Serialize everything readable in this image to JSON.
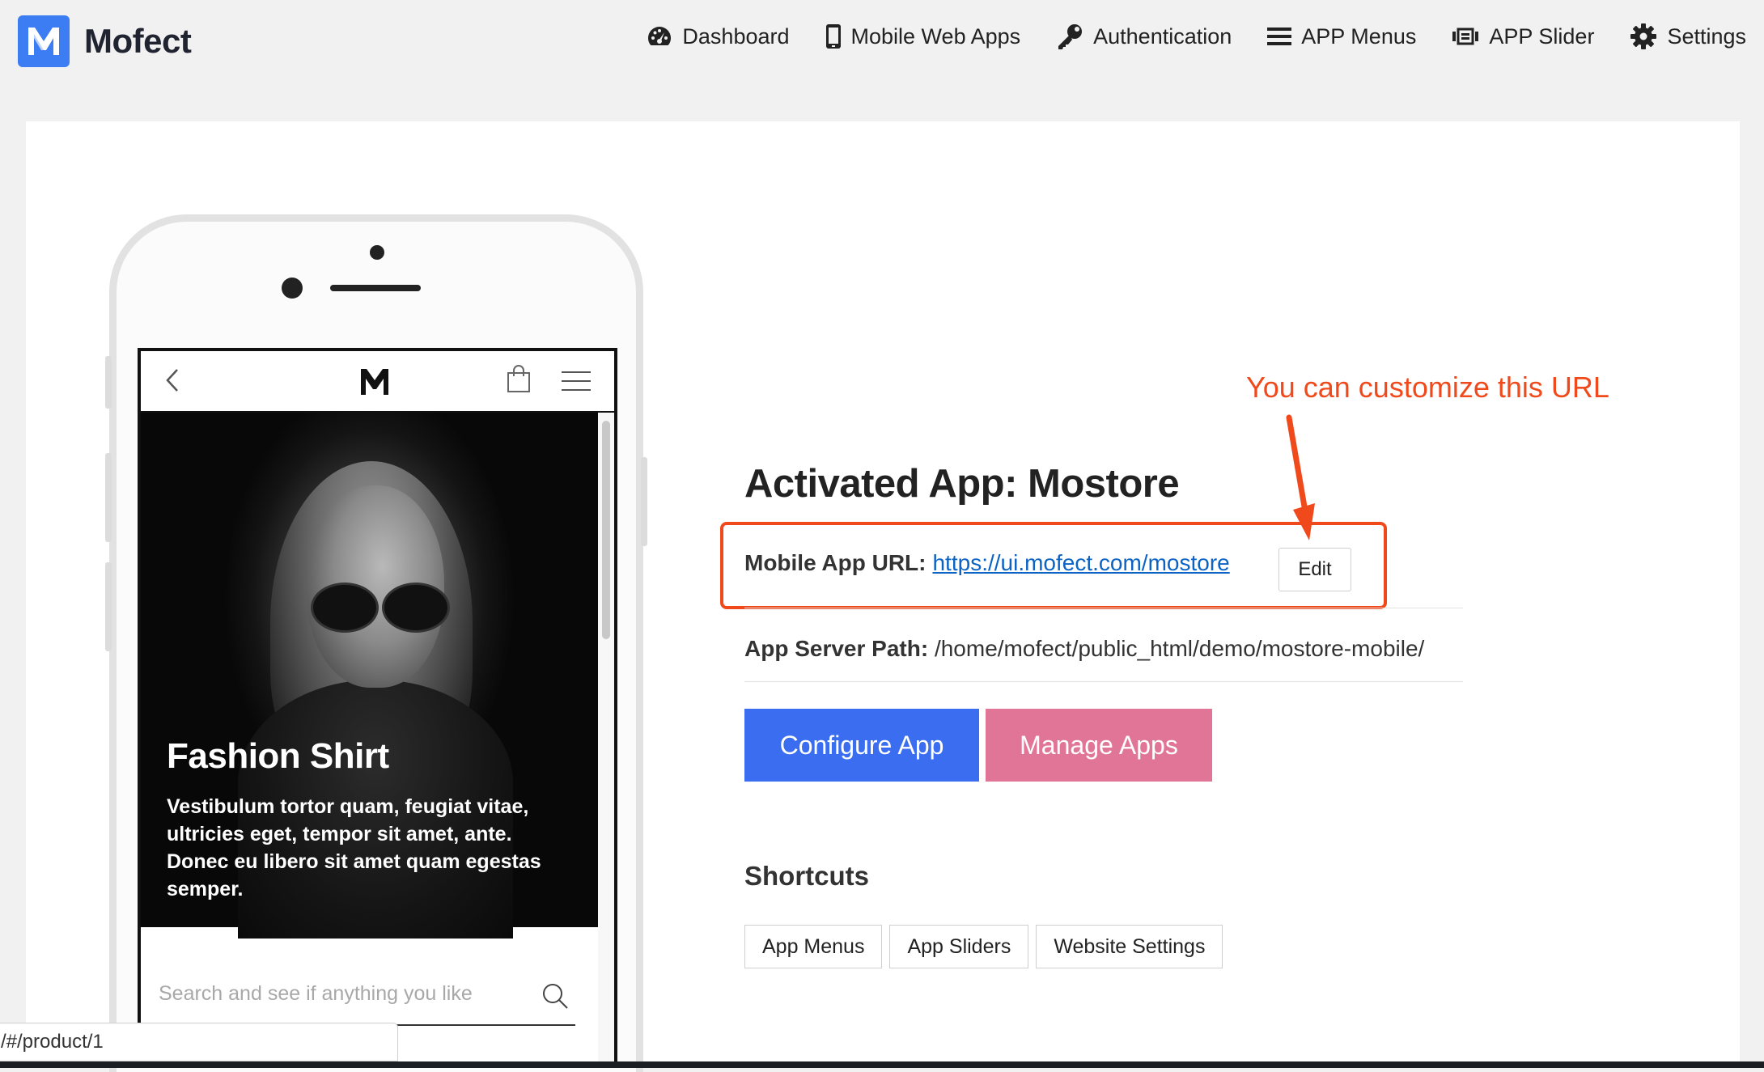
{
  "brand": {
    "name": "Mofect",
    "logo_letter": "M",
    "color": "#3d7df3"
  },
  "nav": [
    {
      "label": "Dashboard",
      "icon": "dashboard-icon"
    },
    {
      "label": "Mobile Web Apps",
      "icon": "mobile-icon"
    },
    {
      "label": "Authentication",
      "icon": "key-icon"
    },
    {
      "label": "APP Menus",
      "icon": "menu-icon"
    },
    {
      "label": "APP Slider",
      "icon": "slider-icon"
    },
    {
      "label": "Settings",
      "icon": "gear-icon"
    }
  ],
  "preview": {
    "logo": "M",
    "hero_title": "Fashion Shirt",
    "hero_text": "Vestibulum tortor quam, feugiat vitae, ultricies eget, tempor sit amet, ante. Donec eu libero sit amet quam egestas semper.",
    "search_placeholder": "Search and see if anything you like"
  },
  "status_url": "/#/product/1",
  "annotation": {
    "text": "You can customize this URL",
    "color": "#f04a1c"
  },
  "app": {
    "title": "Activated App: Mostore",
    "url_label": "Mobile App URL:",
    "url_value": "https://ui.mofect.com/mostore",
    "edit_label": "Edit",
    "path_label": "App Server Path:",
    "path_value": "/home/mofect/public_html/demo/mostore-mobile/",
    "configure_label": "Configure App",
    "manage_label": "Manage Apps",
    "configure_color": "#3a6df0",
    "manage_color": "#e07597"
  },
  "shortcuts": {
    "title": "Shortcuts",
    "items": [
      "App Menus",
      "App Sliders",
      "Website Settings"
    ]
  }
}
